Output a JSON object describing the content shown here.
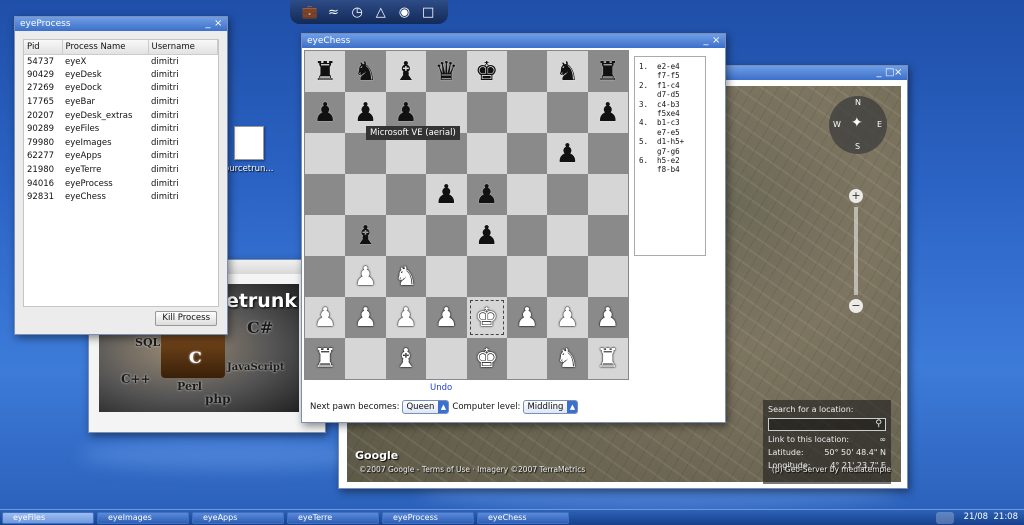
{
  "tray": {
    "icons": [
      "briefcase-icon",
      "wifi-icon",
      "clock-icon",
      "gamepad-icon",
      "network-icon",
      "folder-icon"
    ]
  },
  "process_window": {
    "title": "eyeProcess",
    "columns": [
      "Pid",
      "Process Name",
      "Username"
    ],
    "rows": [
      [
        "54737",
        "eyeX",
        "dimitri"
      ],
      [
        "90429",
        "eyeDesk",
        "dimitri"
      ],
      [
        "27269",
        "eyeDock",
        "dimitri"
      ],
      [
        "17765",
        "eyeBar",
        "dimitri"
      ],
      [
        "20207",
        "eyeDesk_extras",
        "dimitri"
      ],
      [
        "90289",
        "eyeFiles",
        "dimitri"
      ],
      [
        "79980",
        "eyeImages",
        "dimitri"
      ],
      [
        "62277",
        "eyeApps",
        "dimitri"
      ],
      [
        "21980",
        "eyeTerre",
        "dimitri"
      ],
      [
        "94016",
        "eyeProcess",
        "dimitri"
      ],
      [
        "92831",
        "eyeChess",
        "dimitri"
      ]
    ],
    "kill_label": "Kill Process"
  },
  "desktop_icon": {
    "label": "ourcetrun..."
  },
  "images_window": {
    "brand": "rcetrunk",
    "langs": [
      "C#",
      "SQL",
      "C",
      "C++",
      "Perl",
      "JavaScript",
      "php"
    ]
  },
  "chess_window": {
    "title": "eyeChess",
    "tooltip": "Microsoft VE (aerial)",
    "moves": [
      "1.  e2-e4",
      "    f7-f5",
      "2.  f1-c4",
      "    d7-d5",
      "3.  c4-b3",
      "    f5xe4",
      "4.  b1-c3",
      "    e7-e5",
      "5.  d1-h5+",
      "    g7-g6",
      "6.  h5-e2",
      "    f8-b4"
    ],
    "undo_label": "Undo",
    "pawn_label": "Next pawn becomes:",
    "pawn_value": "Queen",
    "level_label": "Computer level:",
    "level_value": "Middling",
    "board": [
      [
        "br",
        "bn",
        "bb",
        "bq",
        "bk",
        "",
        "bn",
        "br"
      ],
      [
        "bp",
        "bp",
        "bp",
        "",
        "",
        "",
        "",
        "bp"
      ],
      [
        "",
        "",
        "",
        "",
        "",
        "",
        "bp",
        ""
      ],
      [
        "",
        "",
        "",
        "bp",
        "bp",
        "",
        "",
        ""
      ],
      [
        "",
        "bb",
        "",
        "",
        "bp",
        "",
        "",
        ""
      ],
      [
        "",
        "wp",
        "wn",
        "",
        "",
        "",
        "",
        ""
      ],
      [
        "wp",
        "wp",
        "wp",
        "wp",
        "sel:wk",
        "wp",
        "wp",
        "wp"
      ],
      [
        "wr",
        "",
        "wb",
        "",
        "wk",
        "",
        "wn",
        "wr"
      ]
    ]
  },
  "map_window": {
    "compass": {
      "n": "N",
      "s": "S",
      "e": "E",
      "w": "W"
    },
    "search_label": "Search for a location:",
    "link_label": "Link to this location:",
    "lat_label": "Latitude:",
    "lat_value": "50° 50' 48.4\" N",
    "lon_label": "Longitude:",
    "lon_value": "4° 21' 23.7\" E",
    "google": "Google",
    "copyright": "©2007 Google - Terms of Use · Imagery ©2007 TerraMetrics",
    "geoserver": "(p) Geo-Server by mediatemple"
  },
  "taskbar": {
    "items": [
      "eyeFiles",
      "eyeImages",
      "eyeApps",
      "eyeTerre",
      "eyeProcess",
      "eyeChess"
    ],
    "active": 0,
    "date": "21/08",
    "time": "21:08"
  }
}
